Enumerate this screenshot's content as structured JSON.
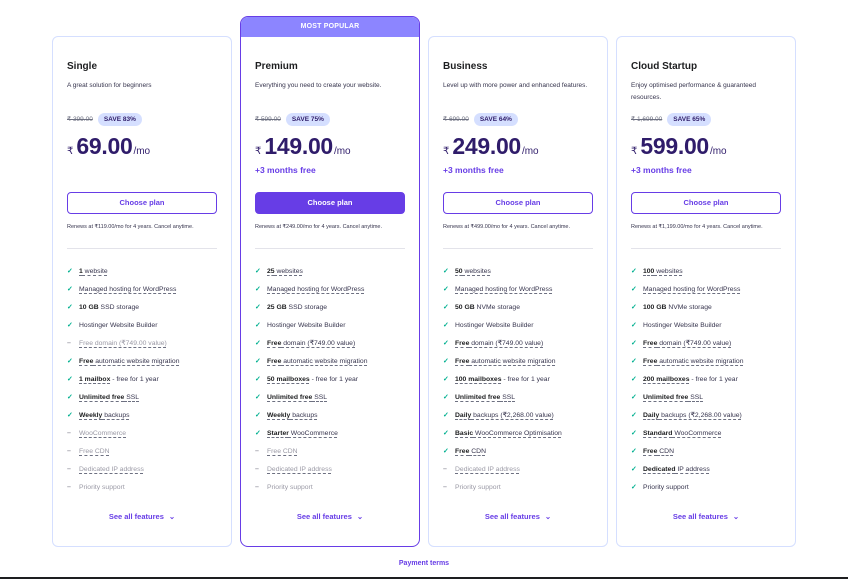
{
  "badge": "MOST POPULAR",
  "see_all": "See all features",
  "chevron": "⌄",
  "payment_terms": "Payment terms",
  "plans": [
    {
      "name": "Single",
      "desc": "A great solution for beginners",
      "old_price": "₹ 399.00",
      "save": "SAVE 83%",
      "currency": "₹",
      "price": "69.00",
      "per": "/mo",
      "extra": "",
      "button": "Choose plan",
      "renew": "Renews at ₹119.00/mo for 4 years. Cancel anytime.",
      "features": [
        {
          "bold": "1",
          "rest": " website",
          "on": true,
          "u": "all"
        },
        {
          "bold": "",
          "rest": "Managed hosting for WordPress",
          "on": true,
          "u": "all"
        },
        {
          "bold": "10 GB",
          "rest": " SSD storage",
          "on": true,
          "u": "none"
        },
        {
          "bold": "",
          "rest": "Hostinger Website Builder",
          "on": true,
          "u": "none"
        },
        {
          "bold": "",
          "rest": "Free domain (₹749.00 value)",
          "on": false,
          "u": "all"
        },
        {
          "bold": "Free",
          "rest": " automatic website migration",
          "on": true,
          "u": "all"
        },
        {
          "bold": "1 mailbox",
          "rest": " - free for 1 year",
          "on": true,
          "u": "bold"
        },
        {
          "bold": "Unlimited free",
          "rest": " SSL",
          "on": true,
          "u": "all"
        },
        {
          "bold": "Weekly",
          "rest": " backups",
          "on": true,
          "u": "all"
        },
        {
          "bold": "",
          "rest": "WooCommerce",
          "on": false,
          "u": "all"
        },
        {
          "bold": "",
          "rest": "Free CDN",
          "on": false,
          "u": "all"
        },
        {
          "bold": "",
          "rest": "Dedicated IP address",
          "on": false,
          "u": "all"
        },
        {
          "bold": "",
          "rest": "Priority support",
          "on": false,
          "u": "none"
        }
      ]
    },
    {
      "name": "Premium",
      "desc": "Everything you need to create your website.",
      "old_price": "₹ 599.00",
      "save": "SAVE 75%",
      "currency": "₹",
      "price": "149.00",
      "per": "/mo",
      "extra": "+3 months free",
      "button": "Choose plan",
      "renew": "Renews at ₹249.00/mo for 4 years. Cancel anytime.",
      "features": [
        {
          "bold": "25",
          "rest": " websites",
          "on": true,
          "u": "all"
        },
        {
          "bold": "",
          "rest": "Managed hosting for WordPress",
          "on": true,
          "u": "all"
        },
        {
          "bold": "25 GB",
          "rest": " SSD storage",
          "on": true,
          "u": "none"
        },
        {
          "bold": "",
          "rest": "Hostinger Website Builder",
          "on": true,
          "u": "none"
        },
        {
          "bold": "Free",
          "rest": " domain (₹749.00 value)",
          "on": true,
          "u": "all"
        },
        {
          "bold": "Free",
          "rest": " automatic website migration",
          "on": true,
          "u": "all"
        },
        {
          "bold": "50 mailboxes",
          "rest": " - free for 1 year",
          "on": true,
          "u": "bold"
        },
        {
          "bold": "Unlimited free",
          "rest": " SSL",
          "on": true,
          "u": "all"
        },
        {
          "bold": "Weekly",
          "rest": " backups",
          "on": true,
          "u": "all"
        },
        {
          "bold": "Starter",
          "rest": " WooCommerce",
          "on": true,
          "u": "all"
        },
        {
          "bold": "",
          "rest": "Free CDN",
          "on": false,
          "u": "all"
        },
        {
          "bold": "",
          "rest": "Dedicated IP address",
          "on": false,
          "u": "all"
        },
        {
          "bold": "",
          "rest": "Priority support",
          "on": false,
          "u": "none"
        }
      ]
    },
    {
      "name": "Business",
      "desc": "Level up with more power and enhanced features.",
      "old_price": "₹ 699.00",
      "save": "SAVE 64%",
      "currency": "₹",
      "price": "249.00",
      "per": "/mo",
      "extra": "+3 months free",
      "button": "Choose plan",
      "renew": "Renews at ₹499.00/mo for 4 years. Cancel anytime.",
      "features": [
        {
          "bold": "50",
          "rest": " websites",
          "on": true,
          "u": "all"
        },
        {
          "bold": "",
          "rest": "Managed hosting for WordPress",
          "on": true,
          "u": "all"
        },
        {
          "bold": "50 GB",
          "rest": " NVMe storage",
          "on": true,
          "u": "none"
        },
        {
          "bold": "",
          "rest": "Hostinger Website Builder",
          "on": true,
          "u": "none"
        },
        {
          "bold": "Free",
          "rest": " domain (₹749.00 value)",
          "on": true,
          "u": "all"
        },
        {
          "bold": "Free",
          "rest": " automatic website migration",
          "on": true,
          "u": "all"
        },
        {
          "bold": "100 mailboxes",
          "rest": " - free for 1 year",
          "on": true,
          "u": "bold"
        },
        {
          "bold": "Unlimited free",
          "rest": " SSL",
          "on": true,
          "u": "all"
        },
        {
          "bold": "Daily",
          "rest": " backups (₹2,268.00 value)",
          "on": true,
          "u": "all"
        },
        {
          "bold": "Basic",
          "rest": " WooCommerce Optimisation",
          "on": true,
          "u": "all"
        },
        {
          "bold": "Free",
          "rest": " CDN",
          "on": true,
          "u": "all"
        },
        {
          "bold": "",
          "rest": "Dedicated IP address",
          "on": false,
          "u": "all"
        },
        {
          "bold": "",
          "rest": "Priority support",
          "on": false,
          "u": "none"
        }
      ]
    },
    {
      "name": "Cloud Startup",
      "desc": "Enjoy optimised performance & guaranteed resources.",
      "old_price": "₹ 1,699.00",
      "save": "SAVE 65%",
      "currency": "₹",
      "price": "599.00",
      "per": "/mo",
      "extra": "+3 months free",
      "button": "Choose plan",
      "renew": "Renews at ₹1,199.00/mo for 4 years. Cancel anytime.",
      "features": [
        {
          "bold": "100",
          "rest": " websites",
          "on": true,
          "u": "all"
        },
        {
          "bold": "",
          "rest": "Managed hosting for WordPress",
          "on": true,
          "u": "all"
        },
        {
          "bold": "100 GB",
          "rest": " NVMe storage",
          "on": true,
          "u": "none"
        },
        {
          "bold": "",
          "rest": "Hostinger Website Builder",
          "on": true,
          "u": "none"
        },
        {
          "bold": "Free",
          "rest": " domain (₹749.00 value)",
          "on": true,
          "u": "all"
        },
        {
          "bold": "Free",
          "rest": " automatic website migration",
          "on": true,
          "u": "all"
        },
        {
          "bold": "200 mailboxes",
          "rest": " - free for 1 year",
          "on": true,
          "u": "bold"
        },
        {
          "bold": "Unlimited free",
          "rest": " SSL",
          "on": true,
          "u": "all"
        },
        {
          "bold": "Daily",
          "rest": " backups (₹2,268.00 value)",
          "on": true,
          "u": "all"
        },
        {
          "bold": "Standard",
          "rest": " WooCommerce",
          "on": true,
          "u": "all"
        },
        {
          "bold": "Free",
          "rest": " CDN",
          "on": true,
          "u": "all"
        },
        {
          "bold": "Dedicated",
          "rest": " IP address",
          "on": true,
          "u": "all"
        },
        {
          "bold": "",
          "rest": "Priority support",
          "on": true,
          "u": "none"
        }
      ]
    }
  ]
}
